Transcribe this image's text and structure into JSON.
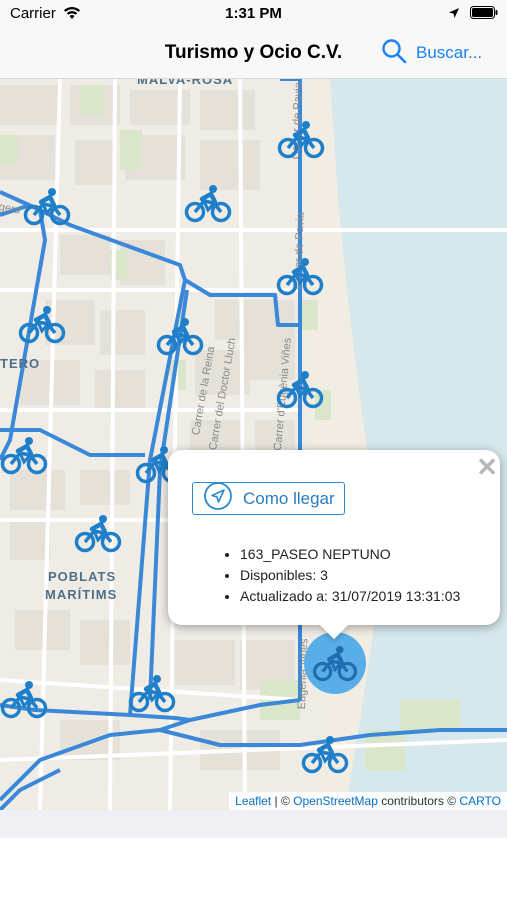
{
  "status_bar": {
    "carrier": "Carrier",
    "time": "1:31 PM"
  },
  "nav": {
    "title": "Turismo y Ocio C.V.",
    "search_label": "Buscar..."
  },
  "map": {
    "districts": [
      {
        "text": "MALVA-ROSA"
      },
      {
        "text": "TERO"
      },
      {
        "text": "POBLATS"
      },
      {
        "text": "MARÍTIMS"
      }
    ],
    "streets": [
      {
        "text": "Carrer de la Reina"
      },
      {
        "text": "Carrer del Doctor Lluch"
      },
      {
        "text": "Carrer d'Eugènia Viñes"
      },
      {
        "text": "Carrer de Pavia"
      },
      {
        "text": "Carrer de Pavia"
      },
      {
        "text": "Eugènia Viñes"
      },
      {
        "text": "gers"
      }
    ],
    "stations_count": 17
  },
  "popup": {
    "button_label": "Como llegar",
    "close_glyph": "✕",
    "items": [
      "163_PASEO NEPTUNO",
      "Disponibles: 3",
      "Actualizado a: 31/07/2019 13:31:03"
    ]
  },
  "attribution": {
    "leaflet": "Leaflet",
    "sep": " | © ",
    "osm": "OpenStreetMap",
    "contrib": " contributors © ",
    "carto": "CARTO"
  },
  "colors": {
    "accent": "#1a82f2",
    "route": "#3b87d8",
    "bike": "#1f7fc9",
    "water": "#d6e8ec"
  }
}
